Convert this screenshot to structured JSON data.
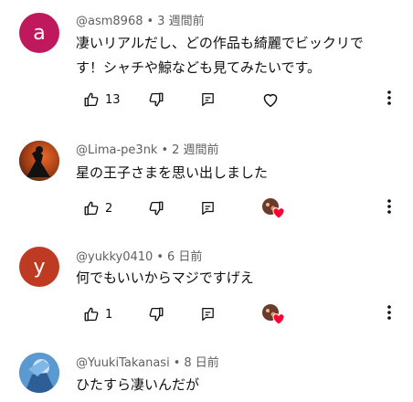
{
  "comments": [
    {
      "avatar_letter": "a",
      "avatar_color": "#c0185d",
      "username": "@asm8968",
      "time": "3 週間前",
      "text_lines": [
        "凄いリアルだし、どの作品も綺麗でビックリで",
        "す！シャチや鯨なども見てみたいです。"
      ],
      "likes": "13",
      "like_icon": "thumb-up-icon",
      "dislike_icon": "thumb-down-icon",
      "reply_icon": "reply-icon",
      "heart_icon": "heart-outline-icon"
    },
    {
      "avatar_letter": "",
      "avatar_color": "#3b2a22",
      "username": "@Lima-pe3nk",
      "time": "2 週間前",
      "text_lines": [
        "星の王子さまを思い出しました"
      ],
      "likes": "2",
      "heart_icon": "creator-heart-icon"
    },
    {
      "avatar_letter": "y",
      "avatar_color": "#bf3a22",
      "username": "@yukky0410",
      "time": "6 日前",
      "text_lines": [
        "何でもいいからマジですげえ"
      ],
      "likes": "1",
      "heart_icon": "creator-heart-icon"
    },
    {
      "avatar_letter": "",
      "avatar_color": "#3f7fb8",
      "username": "@YuukiTakanasi",
      "time": "8 日前",
      "text_lines": [
        "ひたすら凄いんだが"
      ],
      "likes": ""
    }
  ],
  "colors": {
    "heart_red": "#ff0033",
    "meta_grey": "#606060"
  }
}
